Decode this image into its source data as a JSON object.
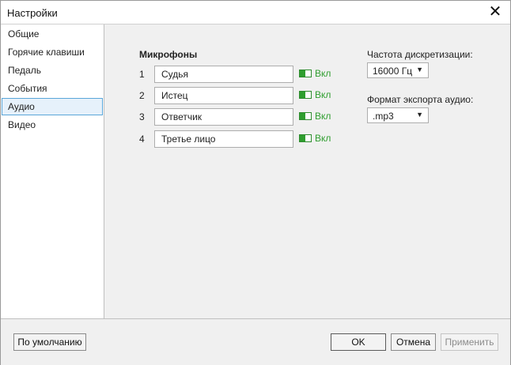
{
  "window": {
    "title": "Настройки"
  },
  "sidebar": {
    "items": [
      {
        "label": "Общие"
      },
      {
        "label": "Горячие клавиши"
      },
      {
        "label": "Педаль"
      },
      {
        "label": "События"
      },
      {
        "label": "Аудио",
        "active": true
      },
      {
        "label": "Видео"
      }
    ]
  },
  "audio": {
    "microphones_title": "Микрофоны",
    "microphones": [
      {
        "number": "1",
        "name": "Судья",
        "toggle": "Вкл"
      },
      {
        "number": "2",
        "name": "Истец",
        "toggle": "Вкл"
      },
      {
        "number": "3",
        "name": "Ответчик",
        "toggle": "Вкл"
      },
      {
        "number": "4",
        "name": "Третье лицо",
        "toggle": "Вкл"
      }
    ],
    "sample_rate": {
      "label": "Частота дискретизации:",
      "value": "16000 Гц"
    },
    "export_format": {
      "label": "Формат экспорта аудио:",
      "value": ".mp3"
    }
  },
  "footer": {
    "defaults_label": "По умолчанию",
    "ok_label": "OK",
    "cancel_label": "Отмена",
    "apply_label": "Применить"
  },
  "colors": {
    "accent_green": "#2f9e2f",
    "selection_border": "#5aa6d9"
  }
}
